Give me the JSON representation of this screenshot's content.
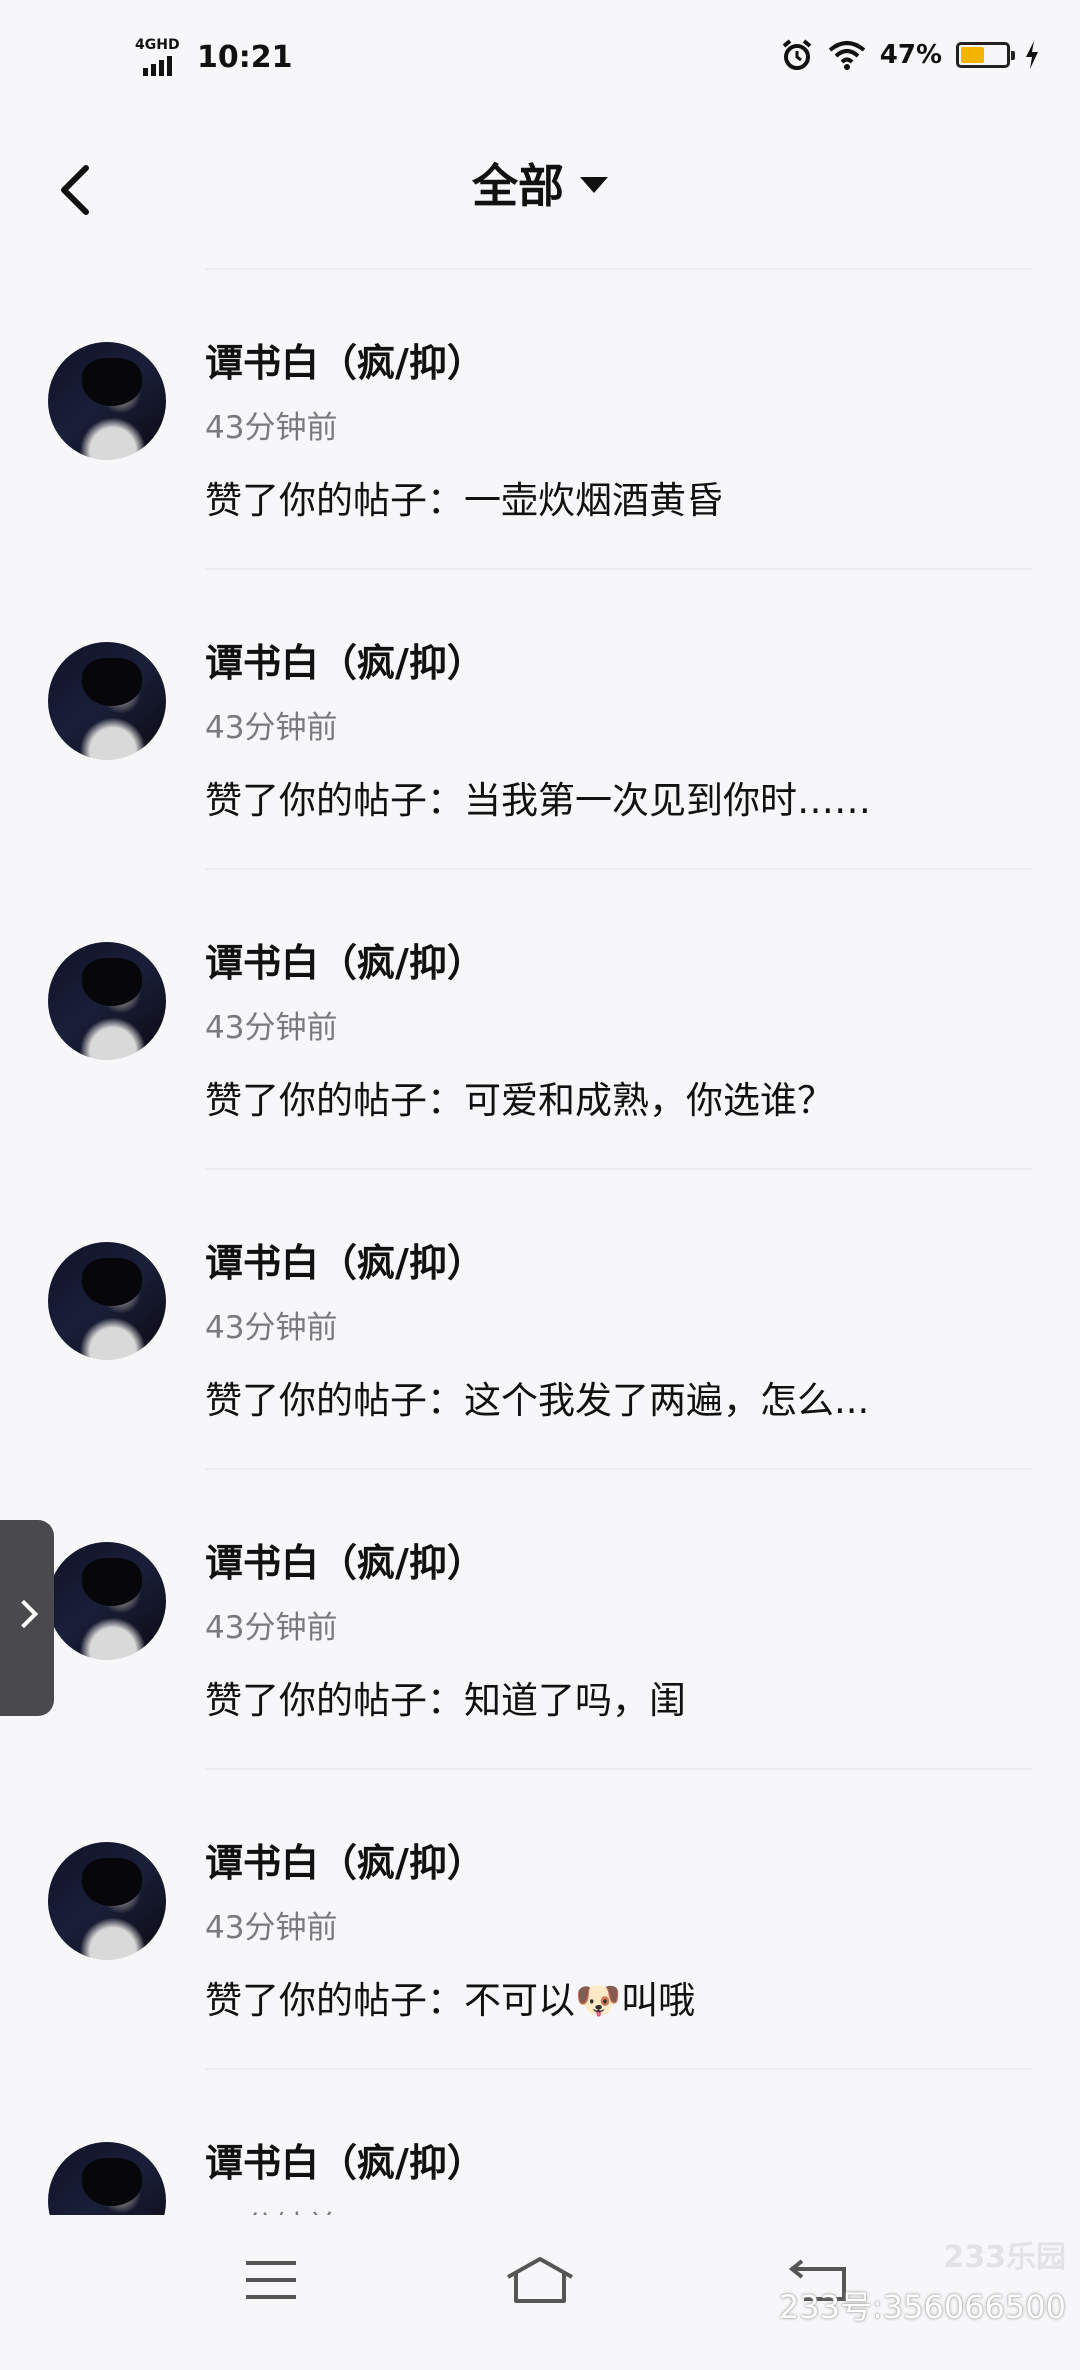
{
  "status_bar": {
    "network": "4GHD",
    "time": "10:21",
    "battery_percent": "47%",
    "battery_level": 0.47,
    "icons": [
      "alarm-icon",
      "wifi-icon",
      "battery-icon",
      "charging-icon"
    ],
    "battery_color": "#f3b400"
  },
  "header": {
    "title": "全部",
    "back_icon": "chevron-left-icon",
    "dropdown_icon": "caret-down-icon"
  },
  "notifications": [
    {
      "name": "谭书白（疯/抑）",
      "time": "43分钟前",
      "prefix": "赞了你的帖子：",
      "text": "一壶炊烟酒黄昏"
    },
    {
      "name": "谭书白（疯/抑）",
      "time": "43分钟前",
      "prefix": "赞了你的帖子：",
      "text": "当我第一次见到你时……"
    },
    {
      "name": "谭书白（疯/抑）",
      "time": "43分钟前",
      "prefix": "赞了你的帖子：",
      "text": "可爱和成熟，你选谁？"
    },
    {
      "name": "谭书白（疯/抑）",
      "time": "43分钟前",
      "prefix": "赞了你的帖子：",
      "text": "这个我发了两遍，怎么..."
    },
    {
      "name": "谭书白（疯/抑）",
      "time": "43分钟前",
      "prefix": "赞了你的帖子：",
      "text": "知道了吗，闺"
    },
    {
      "name": "谭书白（疯/抑）",
      "time": "43分钟前",
      "prefix": "赞了你的帖子：",
      "text": "不可以🐶叫哦"
    },
    {
      "name": "谭书白（疯/抑）",
      "time": "43分钟前",
      "prefix": "",
      "text": ""
    }
  ],
  "nav": {
    "icons": [
      "menu-icon",
      "home-icon",
      "return-icon"
    ]
  },
  "watermark": {
    "logo": "233乐园",
    "id": "233号:356066500"
  }
}
